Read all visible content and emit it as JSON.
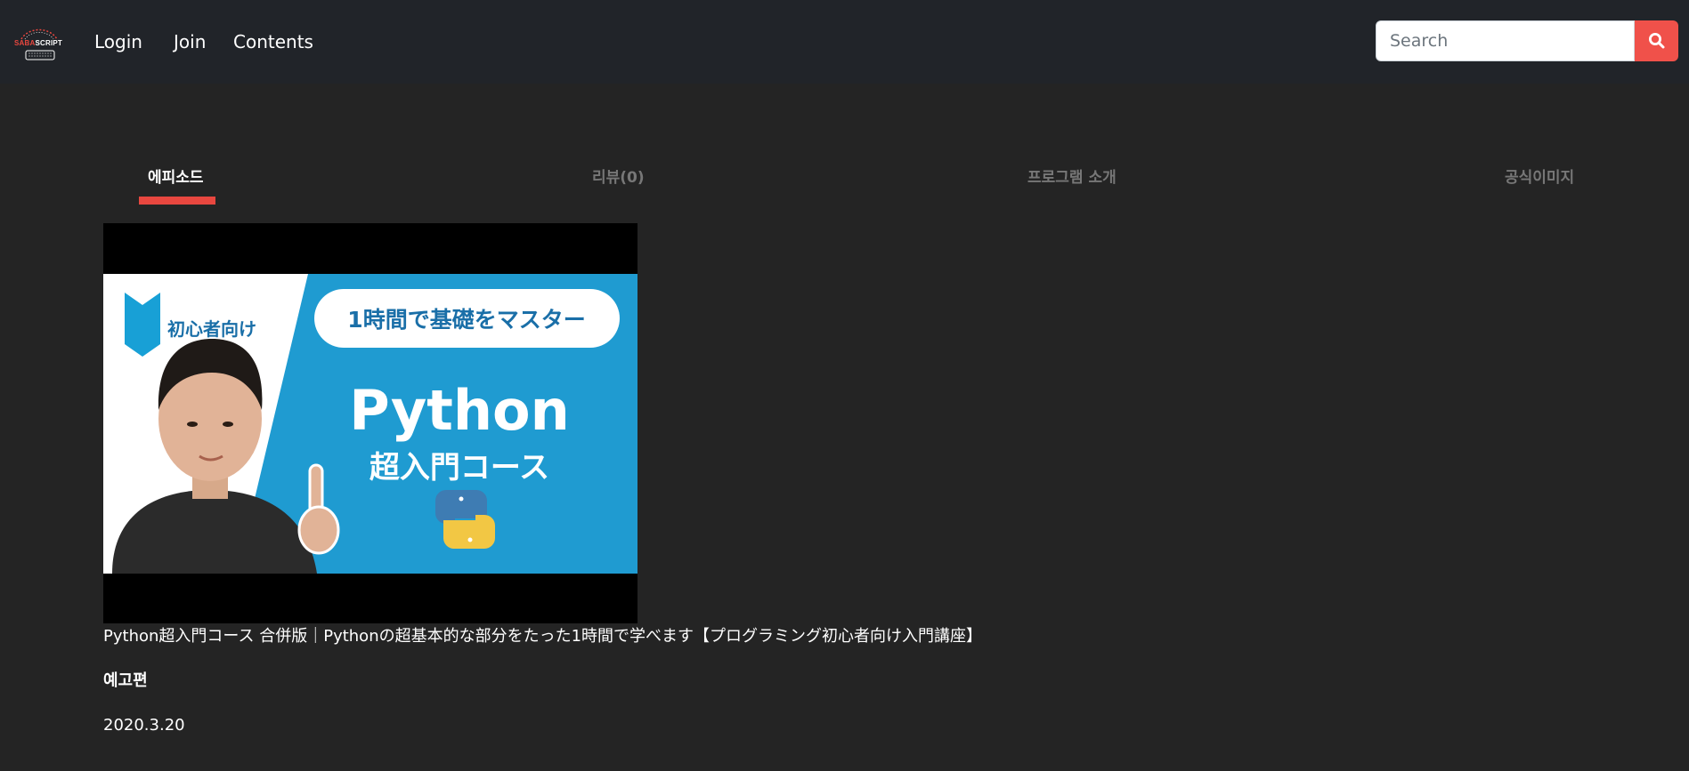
{
  "navbar": {
    "logo": {
      "text_red": "SABA",
      "text_white": "SCRIPT",
      "icon": "sabascript-logo"
    },
    "links": {
      "login": "Login",
      "join": "Join",
      "contents": "Contents"
    },
    "search": {
      "placeholder": "Search",
      "button_icon": "search-icon"
    }
  },
  "tabs": [
    {
      "label": "에피소드",
      "active": true
    },
    {
      "label": "리뷰(0)",
      "active": false
    },
    {
      "label": "프로그램 소개",
      "active": false
    },
    {
      "label": "공식이미지",
      "active": false
    }
  ],
  "episode": {
    "thumbnail": {
      "badge_text": "初心者向け",
      "banner_text": "1時間で基礎をマスター",
      "heading": "Python",
      "subheading": "超入門コース",
      "icon": "python-logo-icon"
    },
    "title": "Python超入門コース 合併版｜Pythonの超基本的な部分をたった1時間で学べます【プログラミング初心者向け入門講座】",
    "label": "예고편",
    "date": "2020.3.20"
  },
  "colors": {
    "accent": "#e8473f",
    "navbar_bg": "#212429",
    "page_bg": "#242424",
    "thumbnail_bg": "#1f9bd1"
  }
}
